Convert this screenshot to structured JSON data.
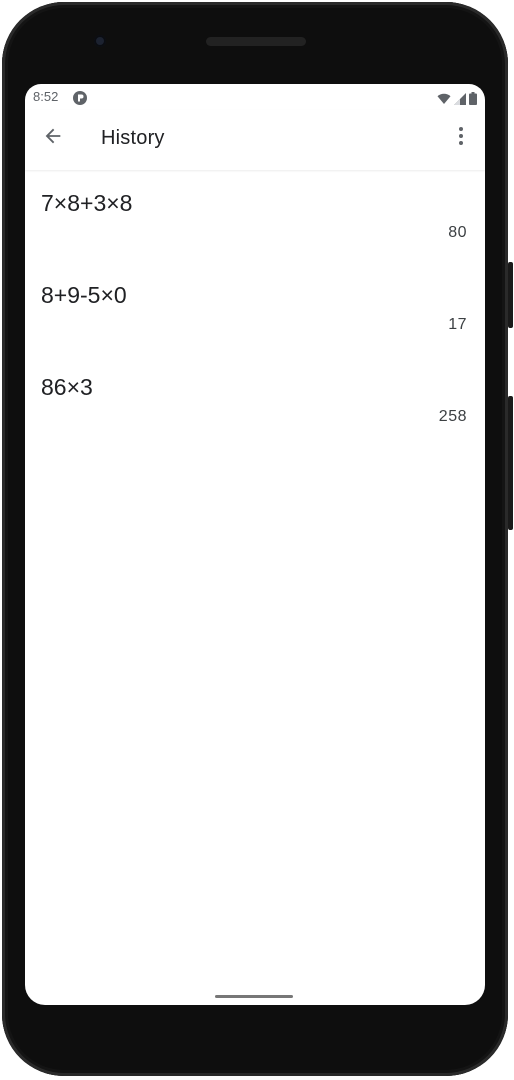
{
  "status_bar": {
    "time": "8:52",
    "app_icon": "notification-app-icon",
    "icons": [
      "wifi-icon",
      "cell-signal-icon",
      "battery-icon"
    ]
  },
  "app_bar": {
    "title": "History",
    "back_icon": "arrow-back-icon",
    "menu_icon": "more-vert-icon"
  },
  "history": [
    {
      "expression": "7×8+3×8",
      "result": "80"
    },
    {
      "expression": "8+9-5×0",
      "result": "17"
    },
    {
      "expression": "86×3",
      "result": "258"
    }
  ],
  "colors": {
    "background": "#ffffff",
    "text_primary": "#202124",
    "text_secondary": "#3c4043",
    "status_text": "#5f6368"
  }
}
